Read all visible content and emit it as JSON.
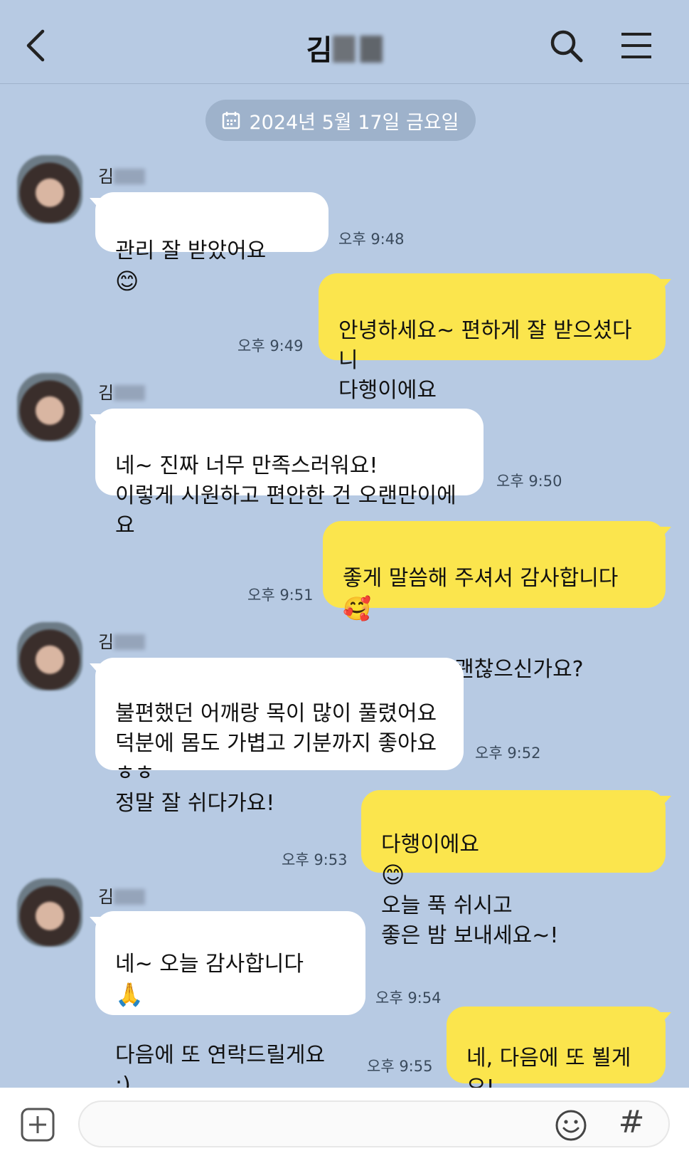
{
  "header": {
    "title": "김",
    "back_icon": "chevron-left-icon",
    "search_icon": "search-icon",
    "menu_icon": "hamburger-menu-icon"
  },
  "date_divider": {
    "icon": "calendar-icon",
    "label": "2024년 5월 17일 금요일"
  },
  "messages": [
    {
      "side": "in",
      "sender": "김",
      "text": "관리 잘 받았어요",
      "emoji": "😊",
      "time": "오후 9:48"
    },
    {
      "side": "out",
      "text": "안녕하세요~ 편하게 잘 받으셨다니\n다행이에요",
      "emoji": "😊",
      "time": "오후 9:49"
    },
    {
      "side": "in",
      "sender": "김",
      "text": "네~ 진짜 너무 만족스러워요!\n이렇게 시원하고 편안한 건 오랜만이에요",
      "time": "오후 9:50"
    },
    {
      "side": "out",
      "text": "좋게 말씀해 주셔서 감사합니다",
      "emoji": "🥰",
      "text2": "불편한 곳은 괜찮으신가요?",
      "time": "오후 9:51"
    },
    {
      "side": "in",
      "sender": "김",
      "text": "불편했던 어깨랑 목이 많이 풀렸어요\n덕분에 몸도 가볍고 기분까지 좋아요 ㅎㅎ\n정말 잘 쉬다가요!",
      "time": "오후 9:52"
    },
    {
      "side": "out",
      "text": "다행이에요",
      "emoji": "😊",
      "text2": "오늘 푹 쉬시고\n좋은 밤 보내세요~!",
      "time": "오후 9:53"
    },
    {
      "side": "in",
      "sender": "김",
      "text": "네~ 오늘 감사합니다",
      "emoji": "🙏",
      "text2": "다음에 또 연락드릴게요 :)\n정말 만족했어요!",
      "time": "오후 9:54"
    },
    {
      "side": "out",
      "text": "네, 다음에 또 뵐게요!\n편안한 밤 되세요",
      "emoji": "😊",
      "time": "오후 9:55"
    }
  ],
  "input_bar": {
    "plus_icon": "plus-square-icon",
    "placeholder": "",
    "emoji_icon": "smiley-icon",
    "hash_label": "#"
  },
  "colors": {
    "background": "#b7cae3",
    "outgoing_bubble": "#fbe54d",
    "incoming_bubble": "#ffffff",
    "date_pill": "#9eb2cb"
  }
}
